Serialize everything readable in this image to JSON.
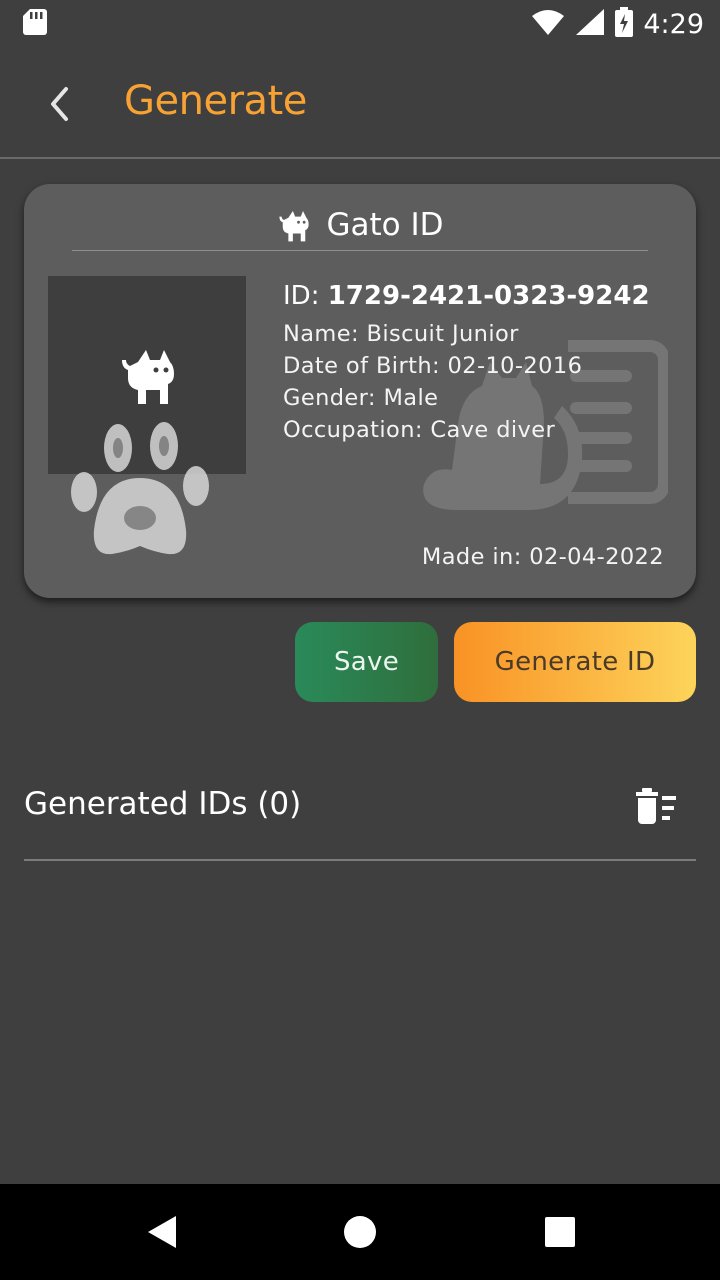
{
  "status_bar": {
    "time": "4:29",
    "icons": [
      "sd-card-icon",
      "wifi-icon",
      "signal-icon",
      "battery-charging-icon"
    ]
  },
  "app_bar": {
    "title": "Generate",
    "title_color": "#f7a233",
    "back_icon": "chevron-left-icon"
  },
  "card": {
    "title": "Gato ID",
    "title_icon": "cat-icon",
    "id_label": "ID: ",
    "id_value": "1729-2421-0323-9242",
    "name": "Name: Biscuit Junior",
    "dob": "Date of Birth: 02-10-2016",
    "gender": "Gender: Male",
    "occupation": "Occupation: Cave diver",
    "made_in": "Made in: 02-04-2022",
    "photo_icon": "cat-icon",
    "paw_print": "paw-print-icon",
    "watermark": "cat-id-card-icon"
  },
  "buttons": {
    "save_label": "Save",
    "generate_label": "Generate ID",
    "save_color": "#2a8a5a",
    "generate_color": "#f99225"
  },
  "generated": {
    "title": "Generated IDs (0)",
    "clear_icon": "delete-sweep-icon"
  },
  "nav_bar": {
    "icons": [
      "back-triangle-icon",
      "home-circle-icon",
      "recents-square-icon"
    ]
  }
}
